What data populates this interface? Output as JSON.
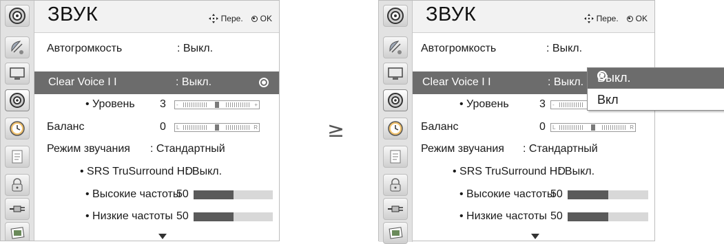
{
  "header": {
    "title": "ЗВУК",
    "nav_hint": "Пере.",
    "ok_hint": "OK"
  },
  "menu": {
    "auto_volume": {
      "label": "Автогромкость",
      "value": ": Выкл."
    },
    "clear_voice": {
      "label": "Clear Voice I I",
      "value": ": Выкл."
    },
    "level": {
      "label": "• Уровень",
      "value": "3",
      "left_mark": "-",
      "right_mark": "+",
      "level_fraction": 0.5
    },
    "balance": {
      "label": "Баланс",
      "value": "0",
      "left_mark": "L",
      "right_mark": "R",
      "level_fraction": 0.5
    },
    "sound_mode": {
      "label": "Режим звучания",
      "value": ": Стандартный"
    },
    "srs": {
      "label": "• SRS TruSurround HD",
      "value": ": Выкл."
    },
    "treble": {
      "label": "• Высокие частоты",
      "value": "50",
      "level_fraction": 0.5
    },
    "bass": {
      "label": "• Низкие частоты",
      "value": "50",
      "level_fraction": 0.5
    }
  },
  "popup": {
    "options": [
      "Выкл.",
      "Вкл"
    ],
    "selected": "Выкл."
  },
  "transition_symbol": "≥",
  "colors": {
    "highlight": "#6c6c6c",
    "bar_fill": "#5a5a5a",
    "bar_track": "#d8d8d8"
  },
  "icons": [
    "satellite-dish-icon",
    "picture-monitor-icon",
    "speaker-icon",
    "clock-icon",
    "option-icon",
    "lock-icon",
    "input-plug-icon",
    "photo-icon"
  ]
}
